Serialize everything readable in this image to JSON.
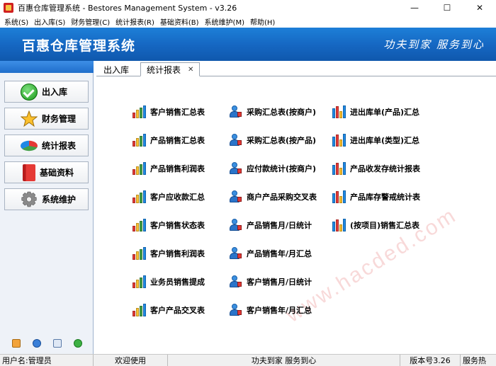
{
  "window": {
    "title": "百惠仓库管理系统 - Bestores Management System - v3.26",
    "minimize": "—",
    "maximize": "☐",
    "close": "✕"
  },
  "menu": [
    "系统(S)",
    "出入库(S)",
    "财务管理(C)",
    "统计报表(R)",
    "基础资料(B)",
    "系统维护(M)",
    "帮助(H)"
  ],
  "banner": {
    "title": "百惠仓库管理系统",
    "slogan": "功夫到家 服务到心"
  },
  "sidebar": {
    "items": [
      {
        "label": "出入库",
        "icon": "check-icon"
      },
      {
        "label": "财务管理",
        "icon": "star-icon"
      },
      {
        "label": "统计报表",
        "icon": "pie-chart-icon"
      },
      {
        "label": "基础资料",
        "icon": "book-icon"
      },
      {
        "label": "系统维护",
        "icon": "gear-icon"
      }
    ],
    "tools": [
      "edit-icon",
      "help-icon",
      "search-icon",
      "exit-icon"
    ]
  },
  "tabs": [
    {
      "label": "出入库"
    },
    {
      "label": "统计报表",
      "close": "✕"
    }
  ],
  "reports": {
    "col1": [
      "客户销售汇总表",
      "产品销售汇总表",
      "产品销售利润表",
      "客户应收款汇总",
      "客户销售状态表",
      "客户销售利润表",
      "业务员销售提成",
      "客户产品交叉表"
    ],
    "col2": [
      "采购汇总表(按商户)",
      "采购汇总表(按产品)",
      "应付款统计(按商户)",
      "商户产品采购交叉表",
      "产品销售月/日统计",
      "产品销售年/月汇总",
      "客户销售月/日统计",
      "客户销售年/月汇总"
    ],
    "col3": [
      "进出库单(产品)汇总",
      "进出库单(类型)汇总",
      "产品收发存统计报表",
      "产品库存警戒统计表",
      "(按项目)销售汇总表"
    ]
  },
  "watermark": "www.hacded.com",
  "status": {
    "user": "用户名:管理员",
    "welcome": "欢迎使用",
    "slogan": "功夫到家 服务到心",
    "version": "版本号3.26",
    "service": "服务热"
  },
  "colors": {
    "banner": "#1566c1",
    "sidebar": "#eef2f8"
  }
}
